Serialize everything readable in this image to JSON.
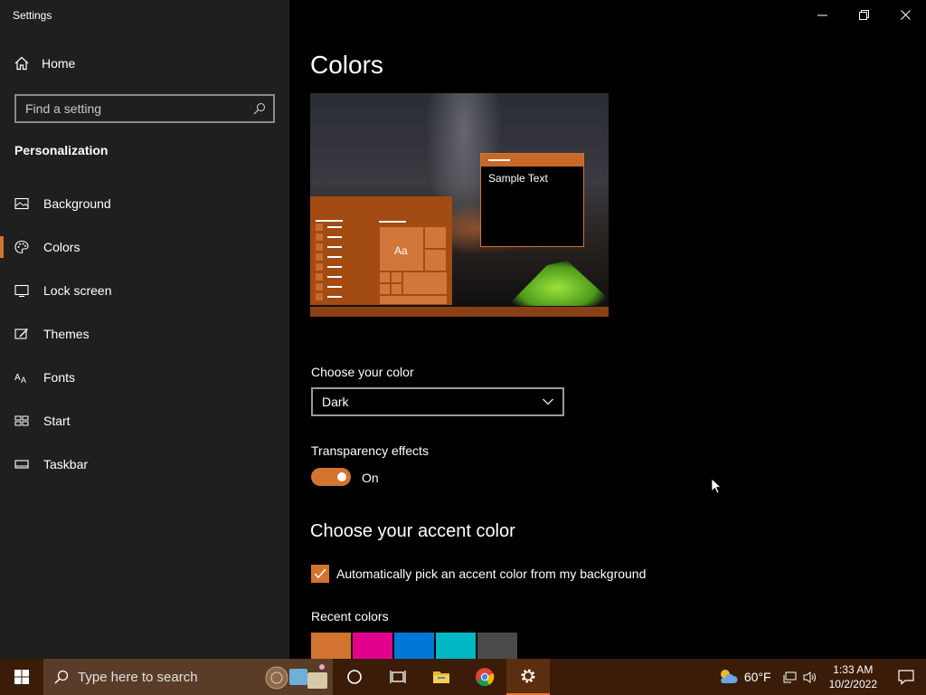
{
  "window": {
    "title": "Settings"
  },
  "sidebar": {
    "home_label": "Home",
    "search_placeholder": "Find a setting",
    "section_title": "Personalization",
    "items": [
      {
        "label": "Background",
        "icon": "picture-icon"
      },
      {
        "label": "Colors",
        "icon": "palette-icon",
        "active": true
      },
      {
        "label": "Lock screen",
        "icon": "lock-screen-icon"
      },
      {
        "label": "Themes",
        "icon": "themes-icon"
      },
      {
        "label": "Fonts",
        "icon": "fonts-icon"
      },
      {
        "label": "Start",
        "icon": "start-icon"
      },
      {
        "label": "Taskbar",
        "icon": "taskbar-icon"
      }
    ]
  },
  "main": {
    "title": "Colors",
    "preview": {
      "sample_text": "Sample Text",
      "tile_text": "Aa"
    },
    "choose_color_label": "Choose your color",
    "choose_color_value": "Dark",
    "transparency_label": "Transparency effects",
    "transparency_state": "On",
    "accent_heading": "Choose your accent color",
    "auto_pick_label": "Automatically pick an accent color from my background",
    "auto_pick_checked": true,
    "recent_colors_label": "Recent colors",
    "recent_colors": [
      "#d2732f",
      "#e3008c",
      "#0078d7",
      "#00b7c3",
      "#4c4a48"
    ]
  },
  "taskbar": {
    "search_placeholder": "Type here to search",
    "weather": "60°F",
    "time": "1:33 AM",
    "date": "10/2/2022"
  },
  "colors": {
    "accent": "#d2732f",
    "sidebar_bg": "#1f1f1f",
    "taskbar_bg": "#3a1c08"
  }
}
